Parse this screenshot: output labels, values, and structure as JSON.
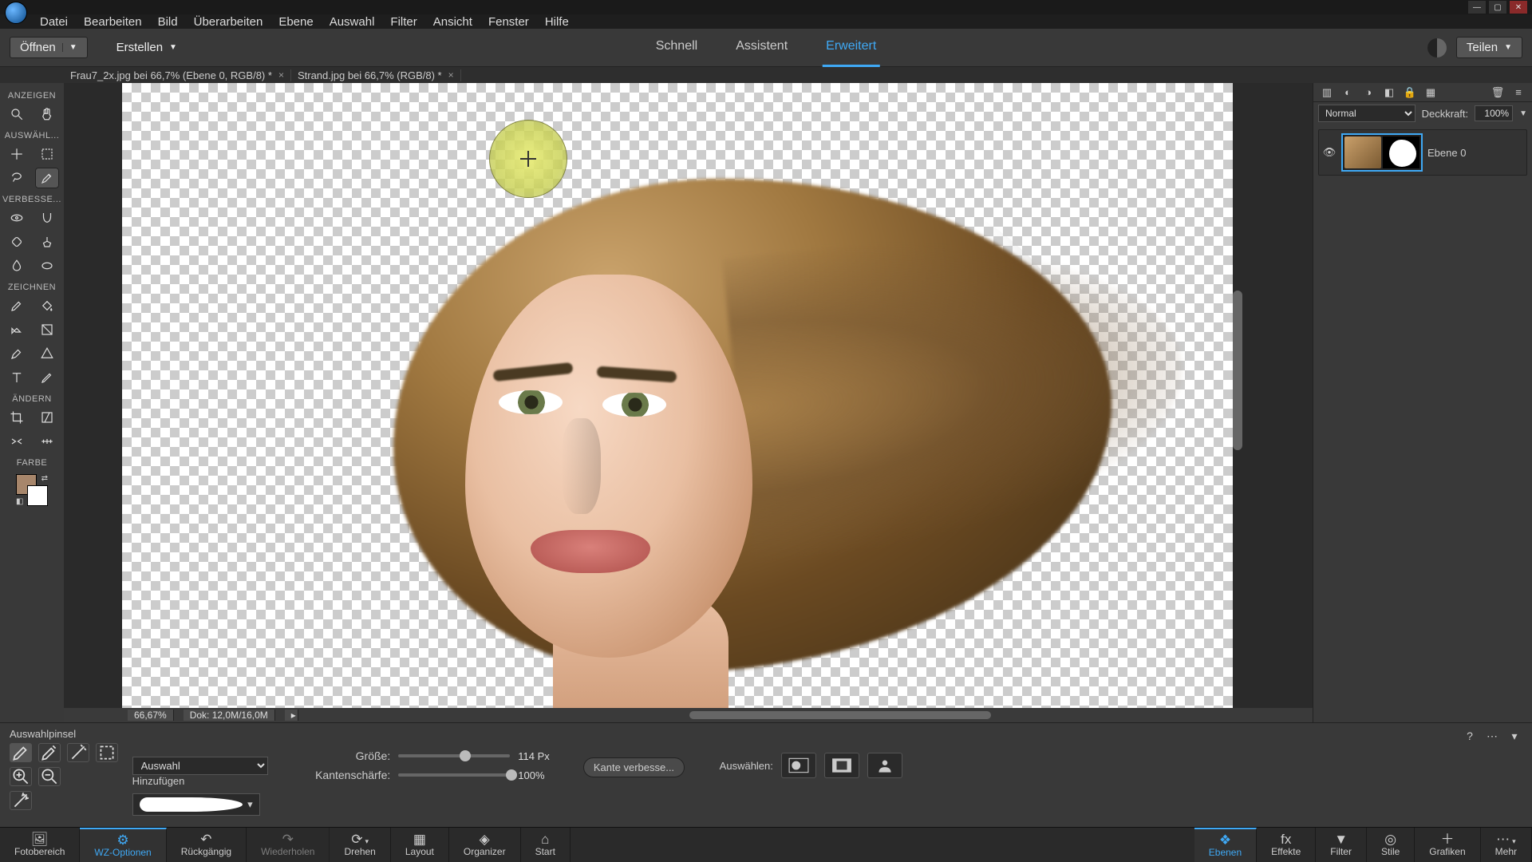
{
  "menu": {
    "datei": "Datei",
    "bearbeiten": "Bearbeiten",
    "bild": "Bild",
    "ueberarbeiten": "Überarbeiten",
    "ebene": "Ebene",
    "auswahl": "Auswahl",
    "filter": "Filter",
    "ansicht": "Ansicht",
    "fenster": "Fenster",
    "hilfe": "Hilfe"
  },
  "actionbar": {
    "open": "Öffnen",
    "create": "Erstellen",
    "quick": "Schnell",
    "guided": "Assistent",
    "expert": "Erweitert",
    "share": "Teilen"
  },
  "tabs": [
    {
      "label": "Frau7_2x.jpg bei 66,7% (Ebene 0, RGB/8) *"
    },
    {
      "label": "Strand.jpg bei 66,7% (RGB/8) *"
    }
  ],
  "tool_sections": {
    "view": "ANZEIGEN",
    "select": "AUSWÄHL...",
    "enhance": "VERBESSE...",
    "draw": "ZEICHNEN",
    "modify": "ÄNDERN",
    "color": "FARBE"
  },
  "status": {
    "zoom": "66,67%",
    "doc": "Dok: 12,0M/16,0M"
  },
  "layers_panel": {
    "blend": "Normal",
    "opacity_label": "Deckkraft:",
    "opacity_value": "100%",
    "layer_name": "Ebene 0"
  },
  "tool_options": {
    "title": "Auswahlpinsel",
    "add_label": "Hinzufügen",
    "mode_label": "",
    "mode_value": "Auswahl",
    "size_label": "Größe:",
    "size_value": "114 Px",
    "hardness_label": "Kantenschärfe:",
    "hardness_value": "100%",
    "refine": "Kante verbesse...",
    "select_label": "Auswählen:"
  },
  "bottombar": {
    "photobin": "Fotobereich",
    "tooloptions": "WZ-Optionen",
    "undo": "Rückgängig",
    "redo": "Wiederholen",
    "rotate": "Drehen",
    "layout": "Layout",
    "organizer": "Organizer",
    "start": "Start",
    "layers": "Ebenen",
    "effects": "Effekte",
    "styles": "Stile",
    "filter": "Filter",
    "graphics": "Grafiken",
    "more": "Mehr"
  }
}
